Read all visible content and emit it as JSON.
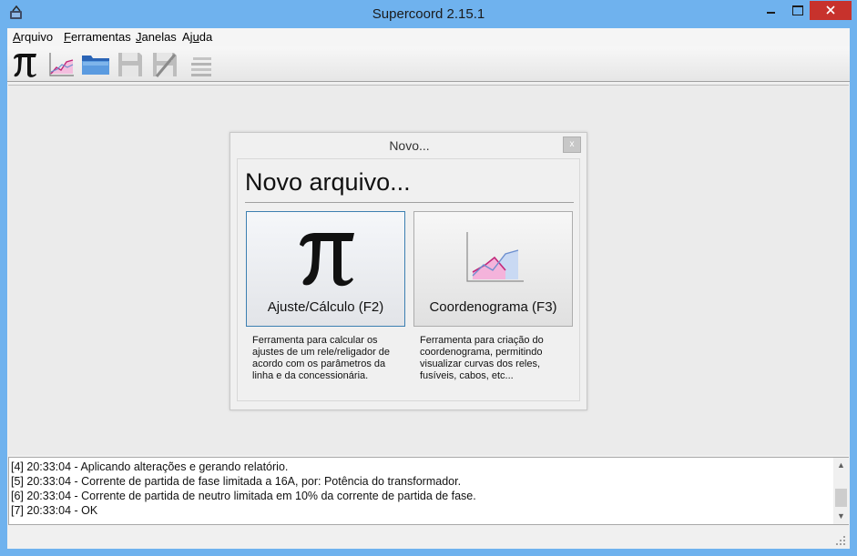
{
  "window": {
    "title": "Supercoord 2.15.1",
    "accent_color": "#6fb2ee",
    "close_color": "#c7322c"
  },
  "menu": [
    {
      "ul": "A",
      "rest": "rquivo"
    },
    {
      "ul": "F",
      "rest": "erramentas"
    },
    {
      "ul": "J",
      "rest": "anelas"
    },
    {
      "pre": "Aj",
      "ul": "u",
      "rest": "da"
    }
  ],
  "toolbar": {
    "icons": [
      "pi-icon",
      "chart-icon",
      "folder-open-icon",
      "save-icon",
      "save-as-icon",
      "list-icon"
    ]
  },
  "dialog": {
    "title": "Novo...",
    "close_label": "x",
    "heading": "Novo arquivo...",
    "options": [
      {
        "label": "Ajuste/Cálculo (F2)",
        "icon": "pi-icon",
        "description": "Ferramenta para calcular os ajustes de um rele/religador de acordo com os parâmetros da linha e da concessionária."
      },
      {
        "label": "Coordenograma (F3)",
        "icon": "chart-icon",
        "description": "Ferramenta para criação do coordenograma, permitindo visualizar curvas dos reles, fusíveis, cabos, etc..."
      }
    ]
  },
  "log": {
    "lines": [
      "[4] 20:33:04 - Aplicando alterações e gerando relatório.",
      "[5] 20:33:04 - Corrente de partida de fase limitada a 16A, por: Potência do transformador.",
      "[6] 20:33:04 - Corrente de partida de neutro limitada em 10% da corrente de partida de fase.",
      "[7] 20:33:04 - OK"
    ]
  }
}
